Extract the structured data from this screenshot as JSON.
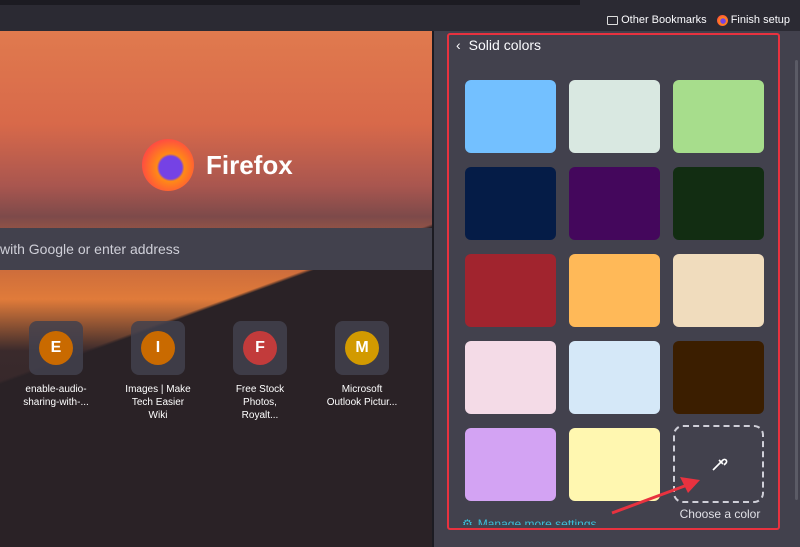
{
  "bookmarks": {
    "other": "Other Bookmarks",
    "finish": "Finish setup"
  },
  "newtab": {
    "brand": "Firefox",
    "search_placeholder": "with Google or enter address",
    "tiles": [
      {
        "letter": "E",
        "label": "enable-audio-\nsharing-with-...",
        "color": "#c96a00"
      },
      {
        "letter": "I",
        "label": "Images | Make\nTech Easier Wiki",
        "color": "#c96a00"
      },
      {
        "letter": "F",
        "label": "Free Stock\nPhotos, Royalt...",
        "color": "#c23b3b"
      },
      {
        "letter": "M",
        "label": "Microsoft\nOutlook Pictur...",
        "color": "#d29a00"
      }
    ]
  },
  "panel": {
    "title": "Solid colors",
    "choose_label": "Choose a color",
    "manage_label": "Manage more settings",
    "swatches": [
      "#73c0ff",
      "#d9e8e1",
      "#a7dd8c",
      "#051c47",
      "#44075c",
      "#122d12",
      "#a1242e",
      "#ffb958",
      "#f0dcbd",
      "#f4dbe7",
      "#d5e8f8",
      "#3b1e00",
      "#d3a3f3",
      "#fff7b0"
    ]
  }
}
